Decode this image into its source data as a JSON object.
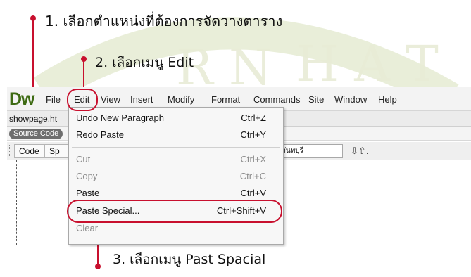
{
  "annotations": {
    "step1": "1. เลือกตำแหน่งที่ต้องการจัดวางตาราง",
    "step2": "2. เลือกเมนู Edit",
    "step3": "3. เลือกเมนู Past Spacial"
  },
  "app": {
    "logo": "Dw",
    "menus": [
      "File",
      "Edit",
      "View",
      "Insert",
      "Modify",
      "Format",
      "Commands",
      "Site",
      "Window",
      "Help"
    ],
    "document_tab": "showpage.ht",
    "source_code_label": "Source Code",
    "view_buttons": [
      "Code",
      "Sp"
    ],
    "title_value": "จันทบุรี",
    "sort_icon": "sort-arrows-icon"
  },
  "edit_menu": {
    "items": [
      {
        "label": "Undo New Paragraph",
        "shortcut": "Ctrl+Z",
        "enabled": true
      },
      {
        "label": "Redo Paste",
        "shortcut": "Ctrl+Y",
        "enabled": true
      },
      {
        "label": "Cut",
        "shortcut": "Ctrl+X",
        "enabled": false
      },
      {
        "label": "Copy",
        "shortcut": "Ctrl+C",
        "enabled": false
      },
      {
        "label": "Paste",
        "shortcut": "Ctrl+V",
        "enabled": true
      },
      {
        "label": "Paste Special...",
        "shortcut": "Ctrl+Shift+V",
        "enabled": true
      },
      {
        "label": "Clear",
        "shortcut": "",
        "enabled": false
      }
    ]
  },
  "colors": {
    "highlight": "#c8102e",
    "logo_green": "#3d6a12",
    "watermark": "#e4ead0"
  }
}
